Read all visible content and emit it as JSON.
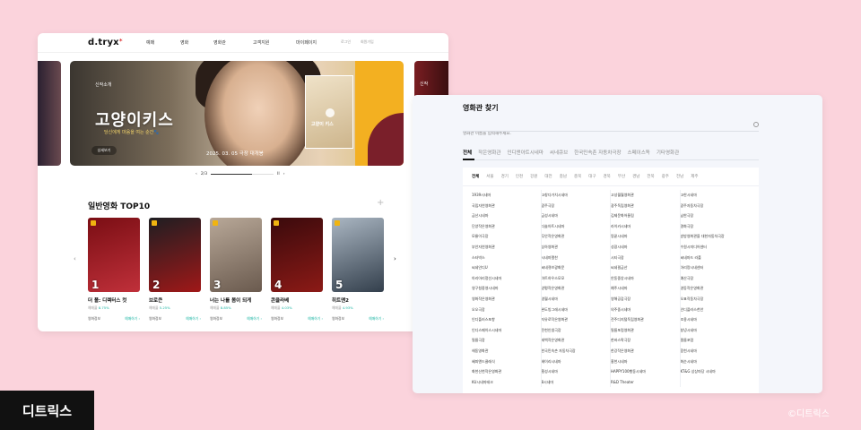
{
  "left_window": {
    "logo": "d.tryx",
    "nav": [
      "예매",
      "영화",
      "영화관",
      "고객지원",
      "마이페이지"
    ],
    "util": [
      "로그인",
      "회원가입"
    ],
    "banner": {
      "peek_right_tag": "신작",
      "sub": "신작소개",
      "title": "고양이키스",
      "tagline": "당신에게 마음을 여는 순간🐾",
      "date": "2025. 03. 05 극장 대개봉",
      "detail_button": "상세보기",
      "poster_title": "고양이 키스"
    },
    "carousel": {
      "prev": "‹",
      "page": "2/3",
      "pause": "II",
      "next": "›",
      "progress": 0.66
    },
    "section_title": "일반영화 TOP10",
    "plus": "+",
    "arrow_prev": "‹",
    "arrow_next": "›",
    "movies": [
      {
        "rank": "1",
        "title": "더 폴: 디렉터스 컷",
        "rate_label": "예매율",
        "rate": "8.75%",
        "info": "영화정보",
        "book": "예매하기 ›",
        "colors": [
          "#7a0e14",
          "#c0303a"
        ]
      },
      {
        "rank": "2",
        "title": "브로큰",
        "rate_label": "예매율",
        "rate": "5.25%",
        "info": "영화정보",
        "book": "예매하기 ›",
        "colors": [
          "#1e1e22",
          "#a01818"
        ]
      },
      {
        "rank": "3",
        "title": "너는 나를 봄이 되게",
        "rate_label": "예매율",
        "rate": "8.85%",
        "info": "영화정보",
        "book": "예매하기 ›",
        "colors": [
          "#b8a898",
          "#6a5a4e"
        ]
      },
      {
        "rank": "4",
        "title": "콘클라베",
        "rate_label": "예매율",
        "rate": "4.03%",
        "info": "영화정보",
        "book": "예매하기 ›",
        "colors": [
          "#3a0a0c",
          "#8c1a16"
        ]
      },
      {
        "rank": "5",
        "title": "히트맨2",
        "rate_label": "예매율",
        "rate": "4.93%",
        "info": "영화정보",
        "book": "예매하기 ›",
        "colors": [
          "#aab6c2",
          "#333f4c"
        ]
      }
    ]
  },
  "right_window": {
    "title": "영화관 찾기",
    "search_placeholder": "영화관 이름을 입력해주세요.",
    "tabs": [
      "전체",
      "작은영화관",
      "인디앤아트시네마",
      "씨네큐브",
      "한국민속촌 자동차극장",
      "스페이스독",
      "기타영화관"
    ],
    "regions": [
      "전체",
      "서울",
      "경기",
      "인천",
      "강원",
      "대전",
      "충남",
      "충북",
      "대구",
      "경북",
      "부산",
      "경남",
      "전북",
      "광주",
      "전남",
      "제주"
    ],
    "theaters": [
      [
        "1939시네마",
        "국립자연영화관",
        "금산시네마",
        "단양작은영화관",
        "모룡이극장",
        "부안자연영화관",
        "스타박스",
        "씨네인디U",
        "아리아리정선시네마",
        "영구청중영시네마",
        "영화작은영화관",
        "오오극장",
        "인디플러스포항",
        "인디스페이스시네마",
        "필름극장",
        "헤동영화관",
        "혜피엔드클레식",
        "화천산천작은영화관",
        "KU시네마테크"
      ],
      [
        "고창다가치시네마",
        "광주극장",
        "금성시네마",
        "다솔아트시네마",
        "무안작은영화관",
        "상하영화관",
        "시네마엘찬",
        "씨네큐브광화문",
        "아트하우스모모",
        "양평작은영화관",
        "영월시네마",
        "완도빙그레시네마",
        "자유로작은영화관",
        "전천인생극장",
        "태백작은영화관",
        "한국민속촌 자동차극장",
        "헤이리시네마",
        "횡성시네마",
        "8시네마"
      ],
      [
        "고성월월영화관",
        "광주독립영화관",
        "김제문화어울림",
        "라이카시네마",
        "땅끝시네마",
        "성광시네마",
        "시티극장",
        "씨네필금산",
        "안동중앙시네마",
        "예주시네마",
        "영해공감극장",
        "의주중시네마",
        "전주디지털독립영화관",
        "필름포럼영화관",
        "한바스팍극장",
        "한강작은영화관",
        "홍천시네마",
        "HAPPY100행동시네마",
        "R&D Theater"
      ],
      [
        "고한시네마",
        "광주자동차극장",
        "남한극장",
        "명화극장",
        "방방영화관을 대한자동차극장",
        "수원시미디어센터",
        "씨네마드 라폴",
        "아리랑시네센터",
        "예산극장",
        "영동작은영화관",
        "오표작동차극장",
        "인디플러스천안",
        "조용시네마",
        "창녕시네마",
        "필름포럼",
        "함천시네마",
        "화순시네마",
        "KT&G 상상마당 시네마"
      ]
    ]
  },
  "labels": {
    "brand": "디트릭스",
    "copyright": "©디트릭스"
  }
}
